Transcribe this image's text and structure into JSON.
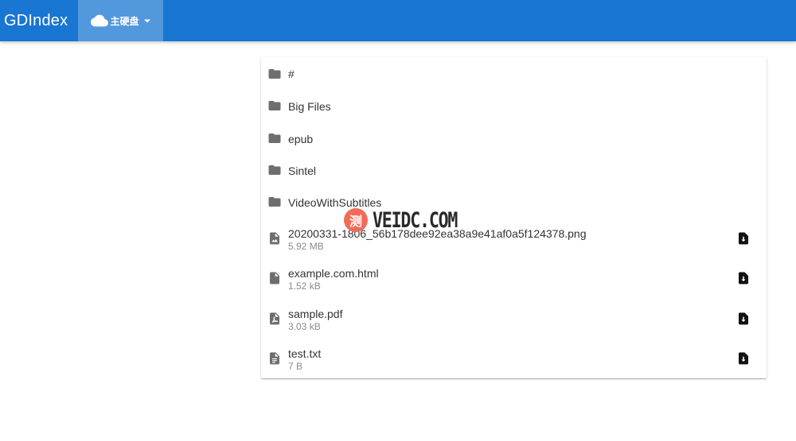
{
  "header": {
    "brand": "GDIndex",
    "drive_label": "主硬盘",
    "drive_icon": "cloud-icon",
    "accent": "#1976d2"
  },
  "files": [
    {
      "name": "#",
      "kind": "folder",
      "size": ""
    },
    {
      "name": "Big Files",
      "kind": "folder",
      "size": ""
    },
    {
      "name": "epub",
      "kind": "folder",
      "size": ""
    },
    {
      "name": "Sintel",
      "kind": "folder",
      "size": ""
    },
    {
      "name": "VideoWithSubtitles",
      "kind": "folder",
      "size": ""
    },
    {
      "name": "20200331-1806_56b178dee92ea38a9e41af0a5f124378.png",
      "kind": "image",
      "size": "5.92 MB"
    },
    {
      "name": "example.com.html",
      "kind": "file",
      "size": "1.52 kB"
    },
    {
      "name": "sample.pdf",
      "kind": "pdf",
      "size": "3.03 kB"
    },
    {
      "name": "test.txt",
      "kind": "text",
      "size": "7 B"
    }
  ],
  "watermark": {
    "badge": "测",
    "text": "VEIDC.COM"
  }
}
